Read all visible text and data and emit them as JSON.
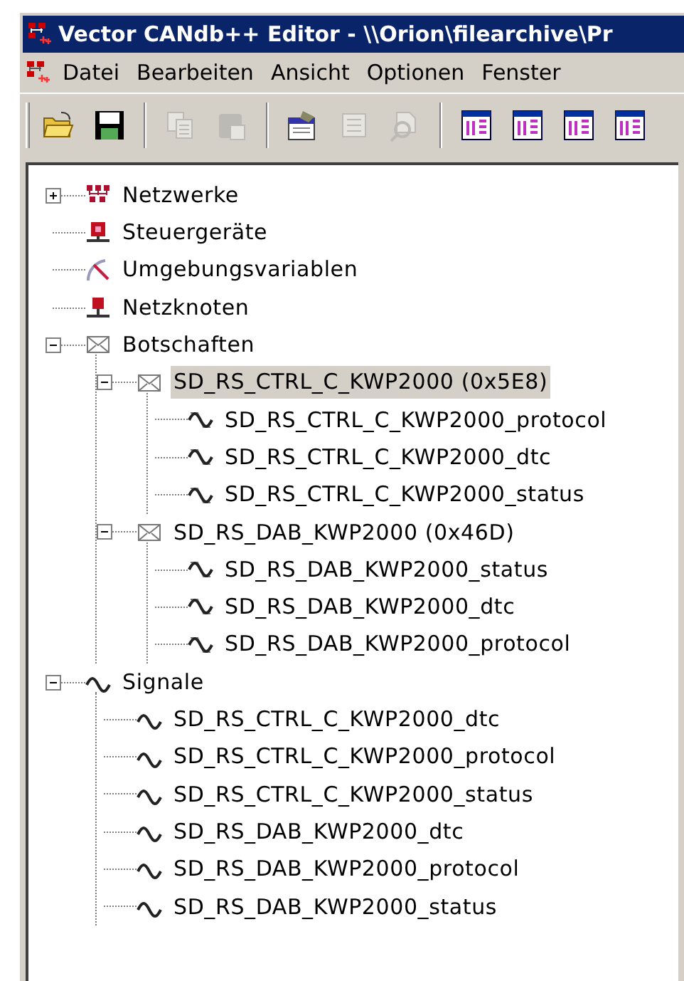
{
  "window": {
    "title": "Vector CANdb++ Editor - \\\\Orion\\filearchive\\Pr"
  },
  "menu": [
    {
      "label": "Datei"
    },
    {
      "label": "Bearbeiten"
    },
    {
      "label": "Ansicht"
    },
    {
      "label": "Optionen"
    },
    {
      "label": "Fenster"
    }
  ],
  "toolbar": [
    {
      "kind": "open",
      "disabled": false
    },
    {
      "kind": "save",
      "disabled": false
    },
    {
      "kind": "separator"
    },
    {
      "kind": "copy",
      "disabled": true
    },
    {
      "kind": "paste",
      "disabled": true
    },
    {
      "kind": "separator"
    },
    {
      "kind": "properties",
      "disabled": false
    },
    {
      "kind": "form",
      "disabled": true
    },
    {
      "kind": "tool",
      "disabled": true
    },
    {
      "kind": "separator"
    },
    {
      "kind": "view",
      "disabled": false
    },
    {
      "kind": "view",
      "disabled": false
    },
    {
      "kind": "view",
      "disabled": false
    },
    {
      "kind": "view",
      "disabled": false
    }
  ],
  "tree": [
    {
      "label": "Netzwerke",
      "kind": "network",
      "expanded": false,
      "selected": false
    },
    {
      "label": "Steuergeräte",
      "kind": "ecu",
      "selected": false
    },
    {
      "label": "Umgebungsvariablen",
      "kind": "envvar",
      "selected": false
    },
    {
      "label": "Netzknoten",
      "kind": "node",
      "selected": false
    },
    {
      "label": "Botschaften",
      "kind": "message",
      "expanded": true,
      "selected": false,
      "children": [
        {
          "label": "SD_RS_CTRL_C_KWP2000 (0x5E8)",
          "kind": "message",
          "expanded": true,
          "selected": true,
          "children": [
            {
              "label": "SD_RS_CTRL_C_KWP2000_protocol",
              "kind": "mapped_signal",
              "selected": false
            },
            {
              "label": "SD_RS_CTRL_C_KWP2000_dtc",
              "kind": "mapped_signal",
              "selected": false
            },
            {
              "label": "SD_RS_CTRL_C_KWP2000_status",
              "kind": "mapped_signal",
              "selected": false
            }
          ]
        },
        {
          "label": "SD_RS_DAB_KWP2000 (0x46D)",
          "kind": "message",
          "expanded": true,
          "selected": false,
          "children": [
            {
              "label": "SD_RS_DAB_KWP2000_status",
              "kind": "mapped_signal",
              "selected": false
            },
            {
              "label": "SD_RS_DAB_KWP2000_dtc",
              "kind": "mapped_signal",
              "selected": false
            },
            {
              "label": "SD_RS_DAB_KWP2000_protocol",
              "kind": "mapped_signal",
              "selected": false
            }
          ]
        }
      ]
    },
    {
      "label": "Signale",
      "kind": "signal",
      "expanded": true,
      "selected": false,
      "children": [
        {
          "label": "SD_RS_CTRL_C_KWP2000_dtc",
          "kind": "signal",
          "selected": false
        },
        {
          "label": "SD_RS_CTRL_C_KWP2000_protocol",
          "kind": "signal",
          "selected": false
        },
        {
          "label": "SD_RS_CTRL_C_KWP2000_status",
          "kind": "signal",
          "selected": false
        },
        {
          "label": "SD_RS_DAB_KWP2000_dtc",
          "kind": "signal",
          "selected": false
        },
        {
          "label": "SD_RS_DAB_KWP2000_protocol",
          "kind": "signal",
          "selected": false
        },
        {
          "label": "SD_RS_DAB_KWP2000_status",
          "kind": "signal",
          "selected": false
        }
      ]
    }
  ]
}
